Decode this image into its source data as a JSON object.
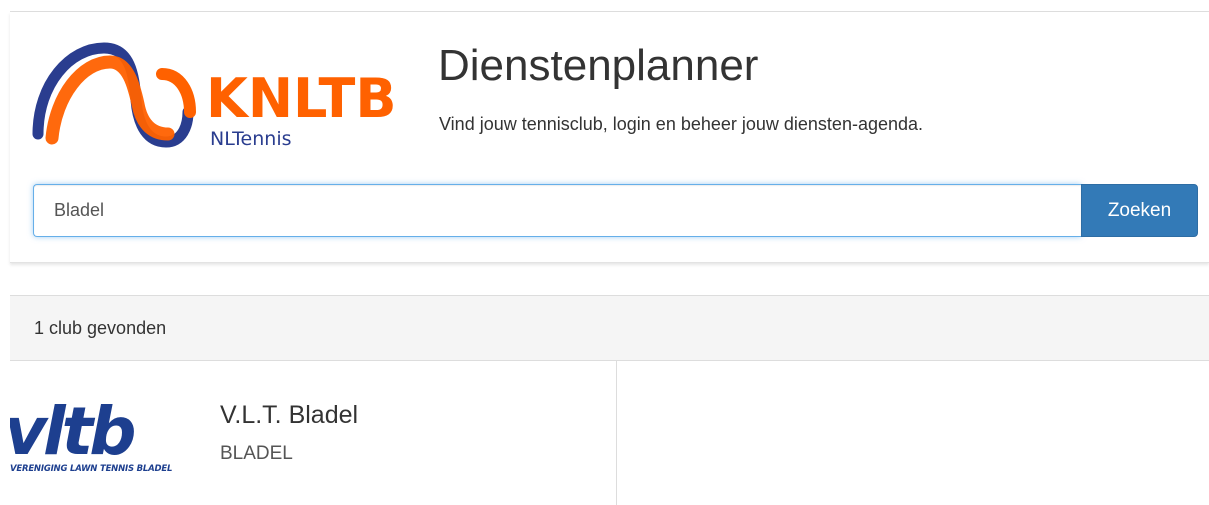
{
  "header": {
    "logo": {
      "wordmark": "KNLTB",
      "subtitle": "NLTennis",
      "colors": {
        "orange": "#ff6100",
        "navy": "#2a3d8f"
      }
    },
    "title": "Dienstenplanner",
    "subtitle": "Vind jouw tennisclub, login en beheer jouw diensten-agenda."
  },
  "search": {
    "value": "Bladel",
    "button_label": "Zoeken",
    "accent": "#337ab7"
  },
  "results": {
    "count_text": "1 club gevonden",
    "clubs": [
      {
        "logo_text": "vltb",
        "logo_tagline": "VERENIGING LAWN TENNIS BLADEL",
        "name": "V.L.T. Bladel",
        "city": "BLADEL"
      }
    ]
  }
}
